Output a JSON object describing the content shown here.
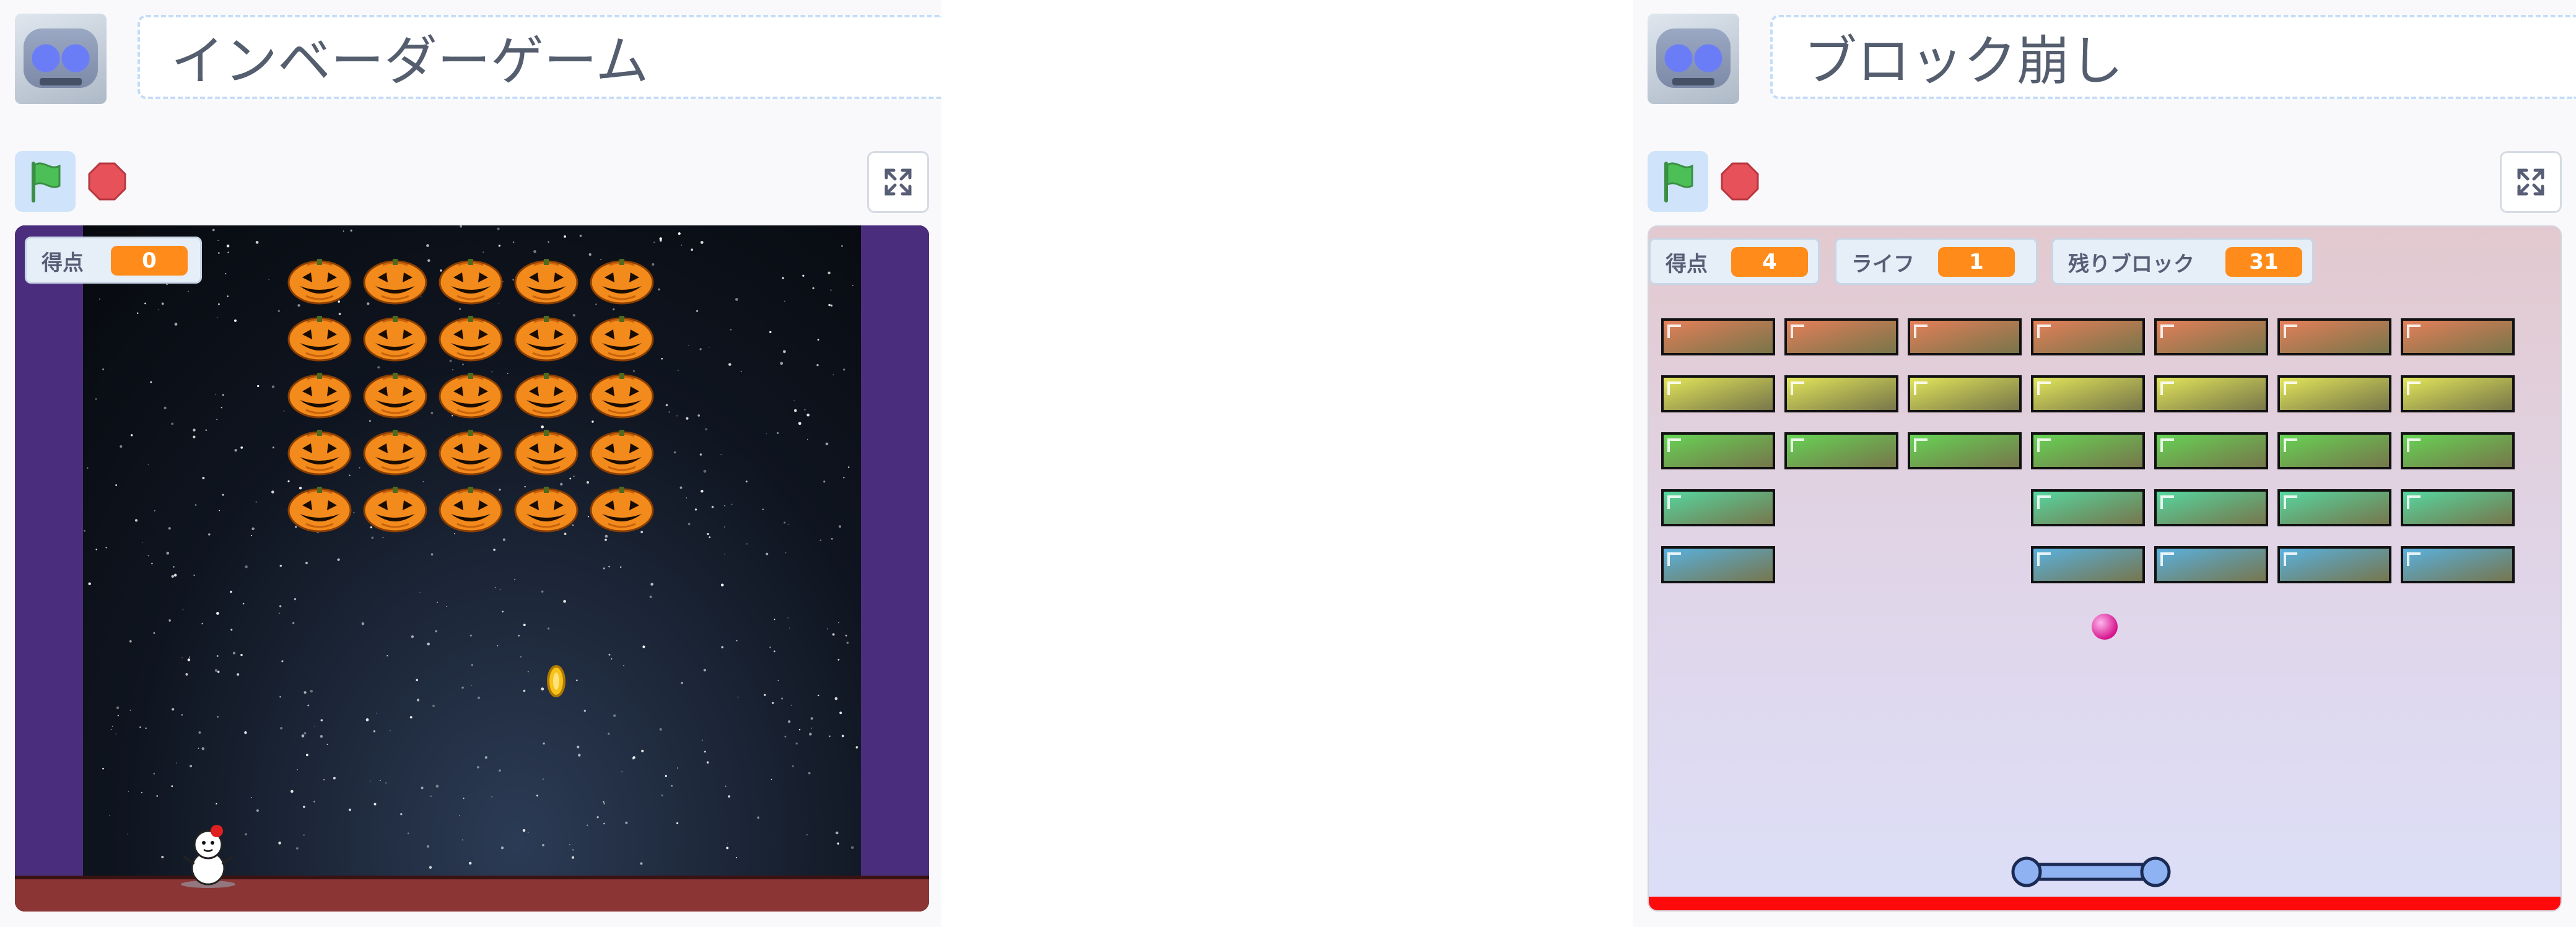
{
  "projects": [
    {
      "title": "インベーダーゲーム",
      "monitors": [
        {
          "label": "得点",
          "value": "0"
        }
      ],
      "sprites": {
        "enemy_rows": 5,
        "enemy_cols": 5,
        "enemy_icon": "pumpkin-icon",
        "player_icon": "snowman-icon",
        "bullet_icon": "coin-icon"
      }
    },
    {
      "title": "ブロック崩し",
      "monitors": [
        {
          "label": "得点",
          "value": "4"
        },
        {
          "label": "ライフ",
          "value": "1"
        },
        {
          "label": "残りブロック",
          "value": "31"
        }
      ],
      "blocks": [
        [
          1,
          1,
          1,
          1,
          1,
          1,
          1
        ],
        [
          1,
          1,
          1,
          1,
          1,
          1,
          1
        ],
        [
          1,
          1,
          1,
          1,
          1,
          1,
          1
        ],
        [
          1,
          0,
          0,
          1,
          1,
          1,
          1
        ],
        [
          1,
          0,
          0,
          1,
          1,
          1,
          1
        ]
      ],
      "block_colors": [
        "#e9805a",
        "#e6ea5a",
        "#66d856",
        "#55dba4",
        "#58b4e6"
      ],
      "sprites": {
        "ball_icon": "ball-icon",
        "paddle_icon": "paddle-icon"
      }
    }
  ],
  "colors": {
    "flag": "#4cbf56",
    "stop": "#e6515a",
    "monitor_value": "#ff8c1a",
    "wall": "#4a2e7d",
    "floor": "#8b3535",
    "deadline": "#ff0a0a"
  }
}
